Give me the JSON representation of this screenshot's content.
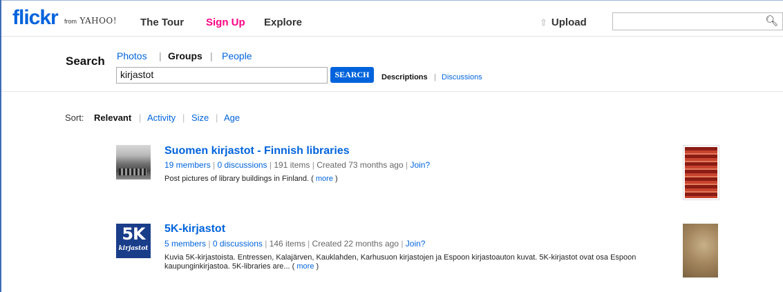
{
  "header": {
    "logo_text": "flickr",
    "logo_from": "from",
    "logo_yahoo": "YAHOO!",
    "nav": {
      "tour": "The Tour",
      "signup": "Sign Up",
      "explore": "Explore"
    },
    "upload": "Upload",
    "search_value": ""
  },
  "search": {
    "label": "Search",
    "tabs": {
      "photos": "Photos",
      "groups": "Groups",
      "people": "People"
    },
    "query": "kirjastot",
    "button": "SEARCH",
    "descriptions": "Descriptions",
    "discussions": "Discussions"
  },
  "sort": {
    "label": "Sort:",
    "relevant": "Relevant",
    "activity": "Activity",
    "size": "Size",
    "age": "Age"
  },
  "results": [
    {
      "title": "Suomen kirjastot - Finnish libraries",
      "members": "19 members",
      "discussions": "0 discussions",
      "items": "191 items",
      "created": "Created 73 months ago",
      "join": "Join?",
      "desc": "Post pictures of library buildings in Finland.",
      "more": "more"
    },
    {
      "title": "5K-kirjastot",
      "icon_big": "5K",
      "icon_small": "kirjastot",
      "members": "5 members",
      "discussions": "0 discussions",
      "items": "146 items",
      "created": "Created 22 months ago",
      "join": "Join?",
      "desc": "Kuvia 5K-kirjastoista. Entressen, Kalajärven, Kauklahden, Karhusuon kirjastojen ja Espoon kirjastoauton kuvat. 5K-kirjastot ovat osa Espoon kaupunginkirjastoa. 5K-libraries are...",
      "more": "more"
    }
  ]
}
